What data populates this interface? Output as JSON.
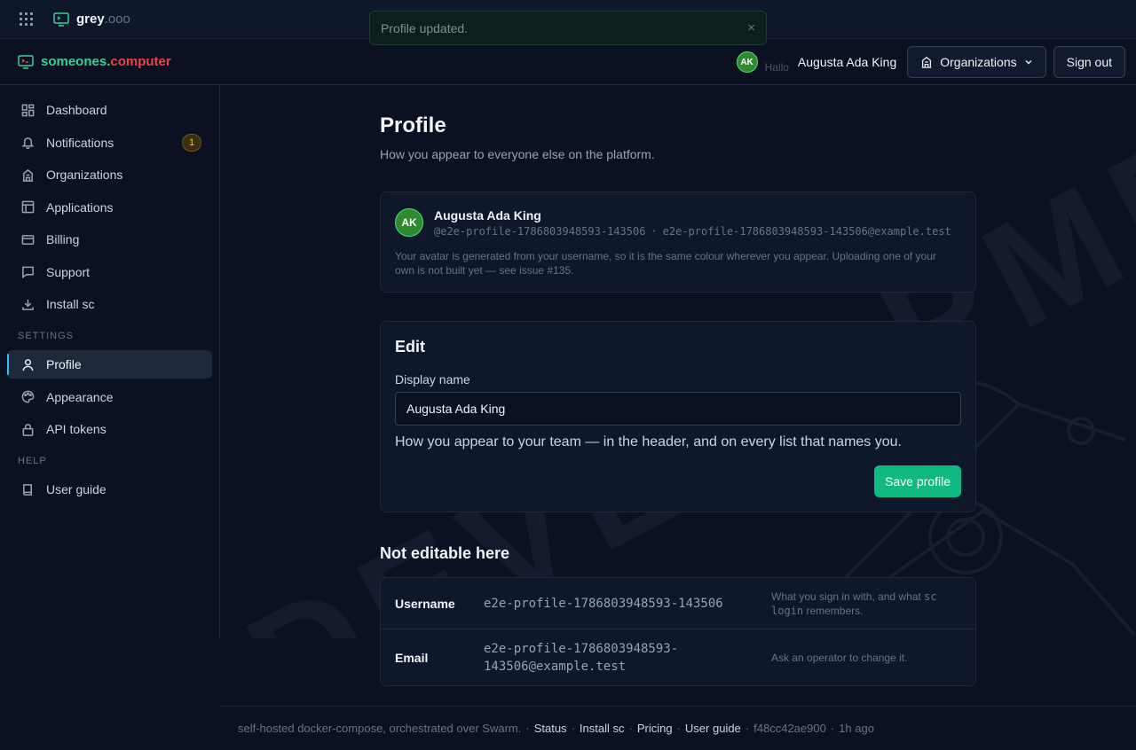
{
  "platform": {
    "name": "grey",
    "suffix": ".ooo"
  },
  "toast": {
    "message": "Profile updated.",
    "close_glyph": "×"
  },
  "brand": {
    "part1": "someones.",
    "part2": "computer"
  },
  "header": {
    "avatar_initials": "AK",
    "greeting": "Hallo",
    "user_name": "Augusta Ada King",
    "organizations_label": "Organizations",
    "sign_out_label": "Sign out"
  },
  "sidebar": {
    "items": [
      {
        "label": "Dashboard",
        "icon": "dashboard-icon"
      },
      {
        "label": "Notifications",
        "icon": "bell-icon",
        "badge": "1"
      },
      {
        "label": "Organizations",
        "icon": "building-icon"
      },
      {
        "label": "Applications",
        "icon": "layout-icon"
      },
      {
        "label": "Billing",
        "icon": "credit-card-icon"
      },
      {
        "label": "Support",
        "icon": "chat-icon"
      },
      {
        "label": "Install sc",
        "icon": "download-icon"
      }
    ],
    "settings_label": "SETTINGS",
    "settings_items": [
      {
        "label": "Profile",
        "icon": "user-icon",
        "active": true
      },
      {
        "label": "Appearance",
        "icon": "palette-icon"
      },
      {
        "label": "API tokens",
        "icon": "lock-icon"
      }
    ],
    "help_label": "HELP",
    "help_items": [
      {
        "label": "User guide",
        "icon": "book-icon"
      }
    ]
  },
  "page": {
    "title": "Profile",
    "subtitle": "How you appear to everyone else on the platform."
  },
  "profile_card": {
    "initials": "AK",
    "name": "Augusta Ada King",
    "handle": "@e2e-profile-1786803948593-143506",
    "separator": "·",
    "email": "e2e-profile-1786803948593-143506@example.test",
    "note": "Your avatar is generated from your username, so it is the same colour wherever you appear. Uploading one of your own is not built yet — see issue #135."
  },
  "edit": {
    "title": "Edit",
    "display_name_label": "Display name",
    "display_name_value": "Augusta Ada King",
    "help": "How you appear to your team — in the header, and on every list that names you.",
    "save_label": "Save profile"
  },
  "not_editable": {
    "title": "Not editable here",
    "rows": [
      {
        "key": "Username",
        "value": "e2e-profile-1786803948593-143506",
        "note_pre": "What you sign in with, and what ",
        "note_code": "sc login",
        "note_post": " remembers."
      },
      {
        "key": "Email",
        "value": "e2e-profile-1786803948593-143506@example.test",
        "note": "Ask an operator to change it."
      }
    ]
  },
  "watermark": "DEVELOPMENT",
  "footer": {
    "prefix": "self-hosted docker-compose, orchestrated over Swarm.",
    "links": [
      "Status",
      "Install sc",
      "Pricing",
      "User guide"
    ],
    "commit": "f48cc42ae900",
    "age": "1h ago",
    "separator": "·"
  }
}
